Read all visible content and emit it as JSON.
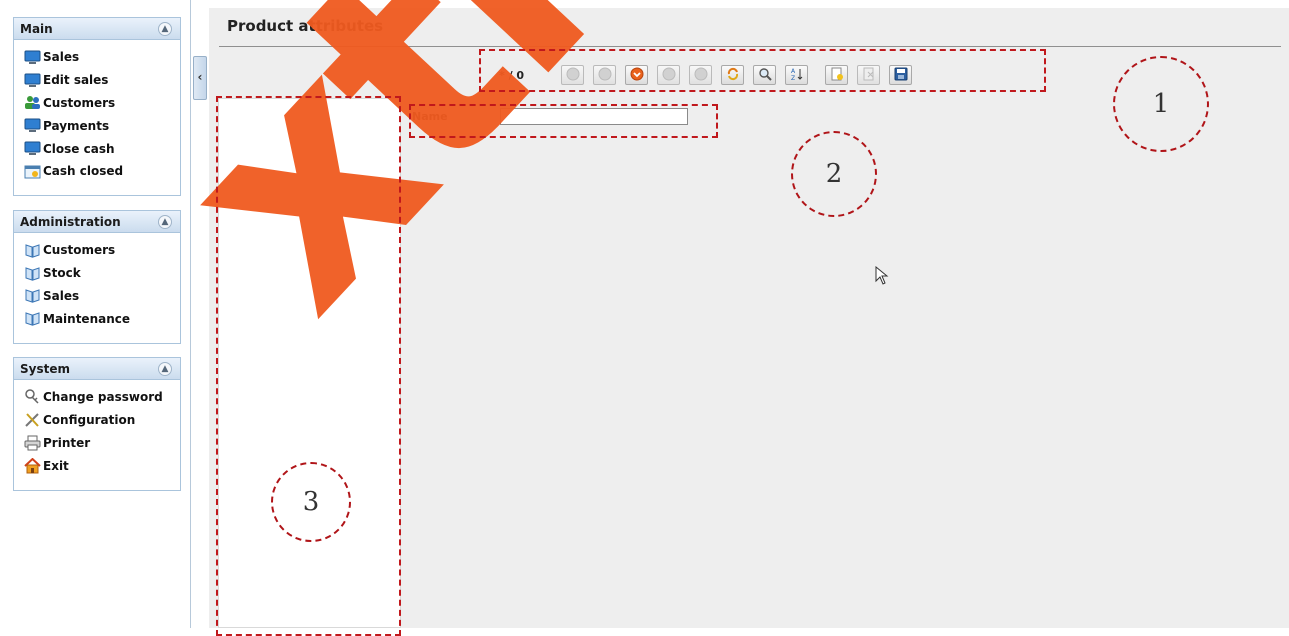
{
  "sidebar": {
    "panels": [
      {
        "title": "Main",
        "items": [
          {
            "label": "Sales",
            "icon": "monitor-icon"
          },
          {
            "label": "Edit sales",
            "icon": "monitor-icon"
          },
          {
            "label": "Customers",
            "icon": "users-icon"
          },
          {
            "label": "Payments",
            "icon": "monitor-icon"
          },
          {
            "label": "Close cash",
            "icon": "monitor-icon"
          },
          {
            "label": "Cash closed",
            "icon": "calendar-icon"
          }
        ]
      },
      {
        "title": "Administration",
        "items": [
          {
            "label": "Customers",
            "icon": "book-icon"
          },
          {
            "label": "Stock",
            "icon": "book-icon"
          },
          {
            "label": "Sales",
            "icon": "book-icon"
          },
          {
            "label": "Maintenance",
            "icon": "book-icon"
          }
        ]
      },
      {
        "title": "System",
        "items": [
          {
            "label": "Change password",
            "icon": "key-icon"
          },
          {
            "label": "Configuration",
            "icon": "tools-icon"
          },
          {
            "label": "Printer",
            "icon": "printer-icon"
          },
          {
            "label": "Exit",
            "icon": "home-icon"
          }
        ]
      }
    ]
  },
  "main": {
    "title": "Product attributes",
    "counter": "* / 0",
    "name_label": "Name",
    "name_value": ""
  },
  "toolbar": {
    "buttons": [
      {
        "icon": "first-record-icon",
        "enabled": false
      },
      {
        "icon": "previous-record-icon",
        "enabled": false
      },
      {
        "icon": "down-arrow-icon",
        "enabled": true
      },
      {
        "icon": "next-record-icon",
        "enabled": false
      },
      {
        "icon": "last-record-icon",
        "enabled": false
      },
      {
        "icon": "reload-icon",
        "enabled": true
      },
      {
        "icon": "search-icon",
        "enabled": true
      },
      {
        "icon": "sort-icon",
        "enabled": true
      },
      {
        "icon": "new-record-icon",
        "enabled": true
      },
      {
        "icon": "delete-icon",
        "enabled": false
      },
      {
        "icon": "save-icon",
        "enabled": true
      }
    ]
  },
  "annotations": {
    "labels": [
      "1",
      "2",
      "3"
    ],
    "color": "#c0181c"
  },
  "watermark": {
    "text": "xtreme",
    "color": "#f05a1f"
  }
}
